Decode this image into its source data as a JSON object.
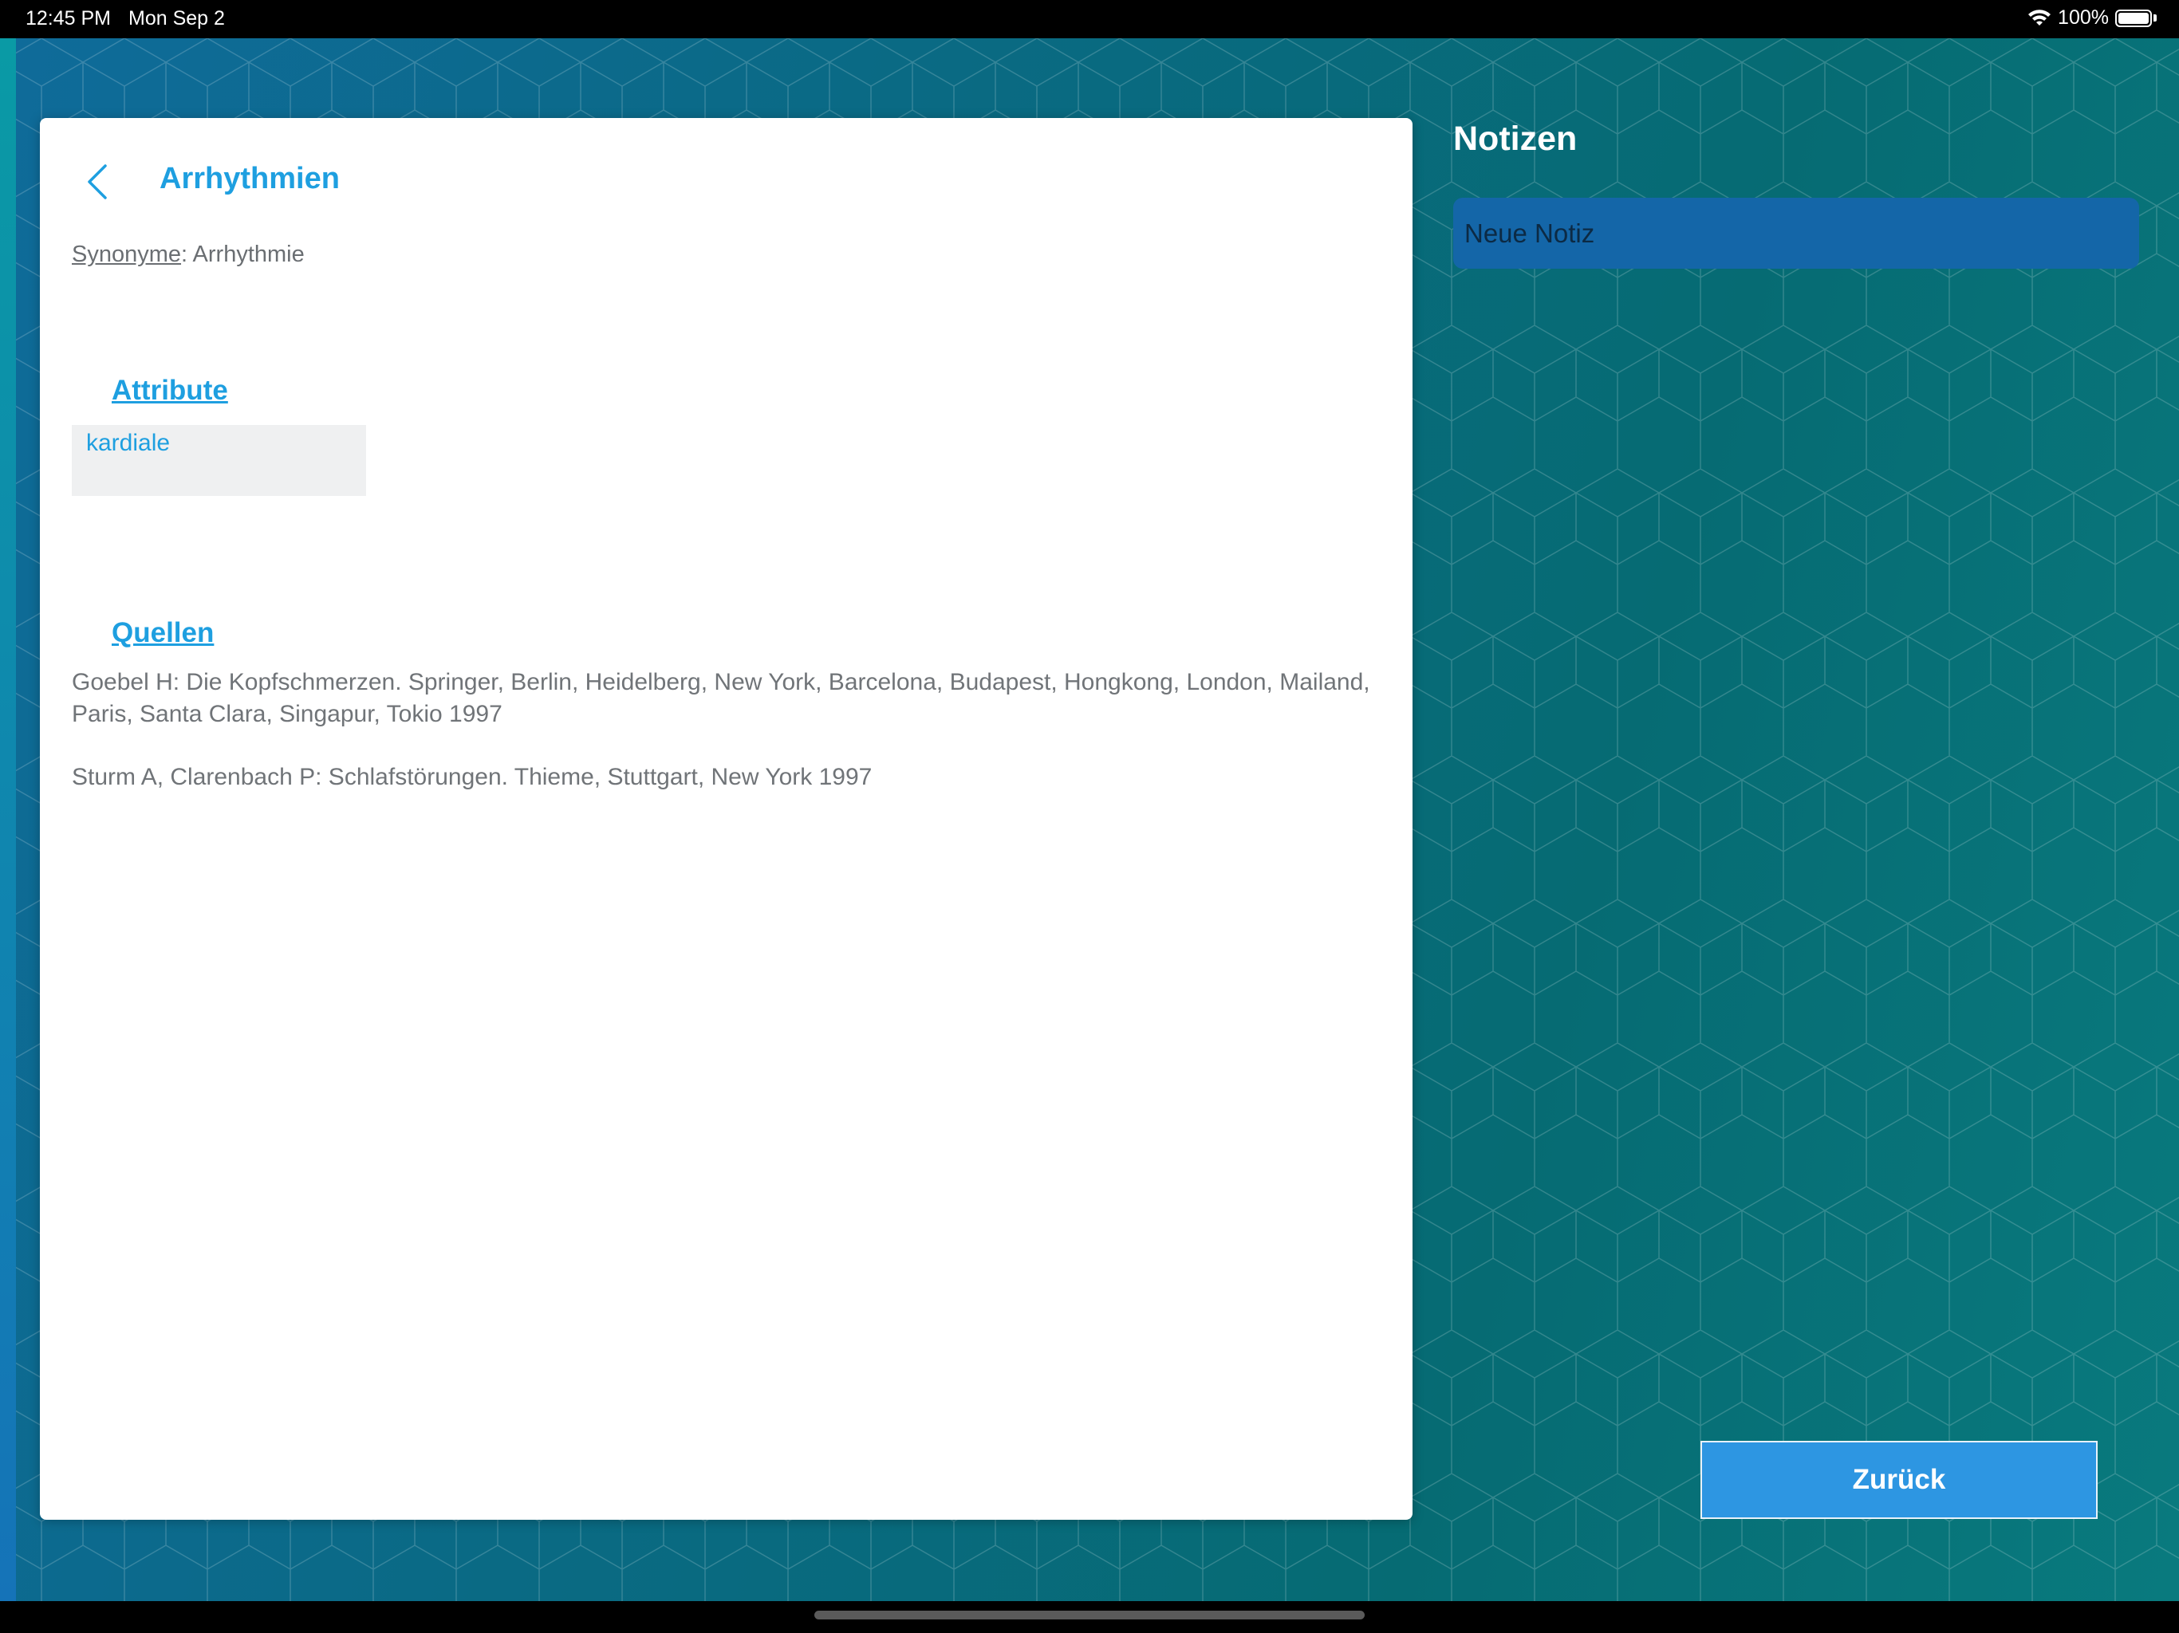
{
  "status_bar": {
    "time": "12:45 PM",
    "date": "Mon Sep 2",
    "battery": "100%"
  },
  "detail": {
    "title": "Arrhythmien",
    "synonyme_label": "Synonyme",
    "synonyme_sep": ": ",
    "synonyme_value": "Arrhythmie",
    "attribute_heading": "Attribute",
    "attributes": [
      "kardiale"
    ],
    "sources_heading": "Quellen",
    "sources": [
      "Goebel H: Die Kopfschmerzen. Springer, Berlin, Heidelberg, New York, Barcelona, Budapest, Hongkong, London, Mailand, Paris, Santa Clara, Singapur, Tokio 1997",
      "Sturm A, Clarenbach P: Schlafstörungen. Thieme, Stuttgart, New York 1997"
    ]
  },
  "notes": {
    "title": "Notizen",
    "new_note_label": "Neue Notiz",
    "back_label": "Zurück"
  },
  "colors": {
    "accent": "#1e9fe0",
    "button": "#2d96e2",
    "note_bg": "#1466a8",
    "bg_teal": "#066b73"
  },
  "icons": {
    "back": "chevron-left-icon",
    "wifi": "wifi-icon",
    "battery": "battery-icon"
  }
}
